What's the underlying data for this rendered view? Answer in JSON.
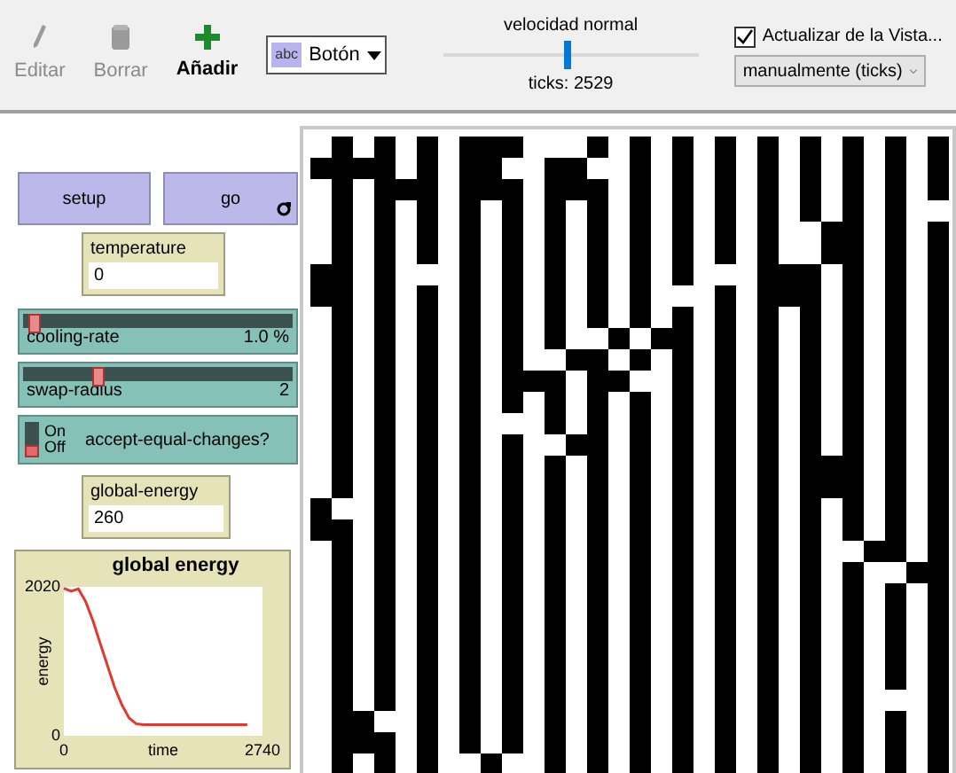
{
  "toolbar": {
    "buttons": [
      {
        "label": "Editar",
        "disabled": true,
        "kind": "edit"
      },
      {
        "label": "Borrar",
        "disabled": true,
        "kind": "delete"
      },
      {
        "label": "Añadir",
        "disabled": false,
        "kind": "add"
      }
    ],
    "widget_chooser": {
      "icon_text": "abc",
      "value": "Botón"
    },
    "speed": {
      "label": "velocidad normal",
      "level": 0.49,
      "ticks": "ticks: 2529"
    },
    "view_updates": {
      "label": "Actualizar de la Vista...",
      "checked": true,
      "mode": "manualmente (ticks)"
    }
  },
  "widgets": [
    {
      "kind": "button",
      "label": "setup",
      "forever": false
    },
    {
      "kind": "button",
      "label": "go",
      "forever": true
    },
    {
      "kind": "monitor",
      "label": "temperature",
      "value": "0"
    },
    {
      "kind": "slider",
      "label": "cooling-rate",
      "reading": "1.0 %",
      "level": 0.02
    },
    {
      "kind": "slider",
      "label": "swap-radius",
      "reading": "2",
      "level": 0.27
    },
    {
      "kind": "switch",
      "label": "accept-equal-changes?",
      "on_text": "On",
      "off_text": "Off",
      "on": false
    },
    {
      "kind": "monitor",
      "label": "global-energy",
      "value": "260"
    },
    {
      "kind": "plot",
      "chart_data": {
        "type": "line",
        "title": "global energy",
        "xlabel": "time",
        "ylabel": "energy",
        "xlim": [
          0,
          2740
        ],
        "ylim": [
          0,
          2020
        ],
        "xticks": [
          0,
          2740
        ],
        "yticks": [
          0,
          2020
        ],
        "x": [
          0,
          100,
          200,
          300,
          400,
          500,
          600,
          700,
          800,
          900,
          1000,
          1100,
          1300,
          1500,
          1700,
          1900,
          2100,
          2300,
          2529
        ],
        "series": [
          {
            "color": "#e03a30",
            "values": [
              2000,
              1960,
              1990,
              1820,
              1560,
              1260,
              960,
              660,
              420,
              240,
              160,
              150,
              150,
              150,
              150,
              150,
              150,
              150,
              150
            ]
          }
        ]
      }
    }
  ]
}
